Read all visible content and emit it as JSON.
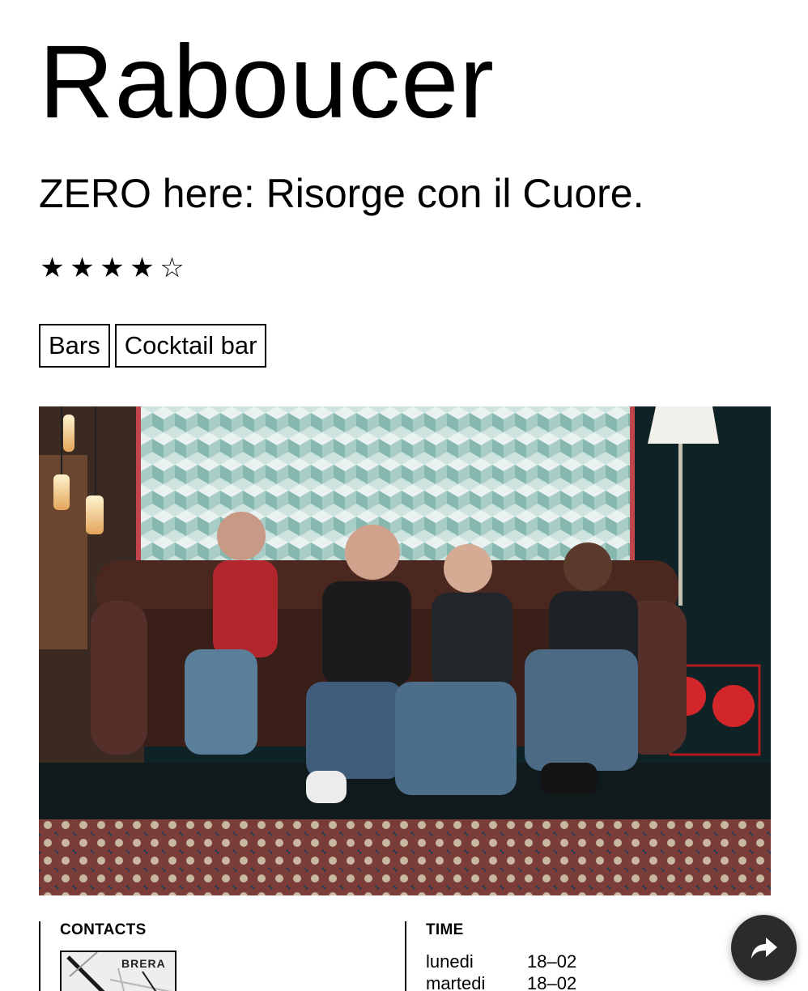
{
  "venue": {
    "name": "Raboucer",
    "tagline": "ZERO here: Risorge con il Cuore.",
    "rating": {
      "value": 4,
      "max": 5
    }
  },
  "tags": [
    "Bars",
    "Cocktail bar"
  ],
  "contacts": {
    "heading": "CONTACTS",
    "map_label": "BRERA"
  },
  "time": {
    "heading": "TIME",
    "hours": [
      {
        "day": "lunedi",
        "hours": "18–02"
      },
      {
        "day": "martedi",
        "hours": "18–02"
      }
    ]
  },
  "icons": {
    "star_filled": "star-filled-icon",
    "star_empty": "star-empty-icon",
    "share": "share-arrow-icon"
  },
  "colors": {
    "text": "#000000",
    "background": "#ffffff",
    "share_button": "#2b2b2b"
  }
}
